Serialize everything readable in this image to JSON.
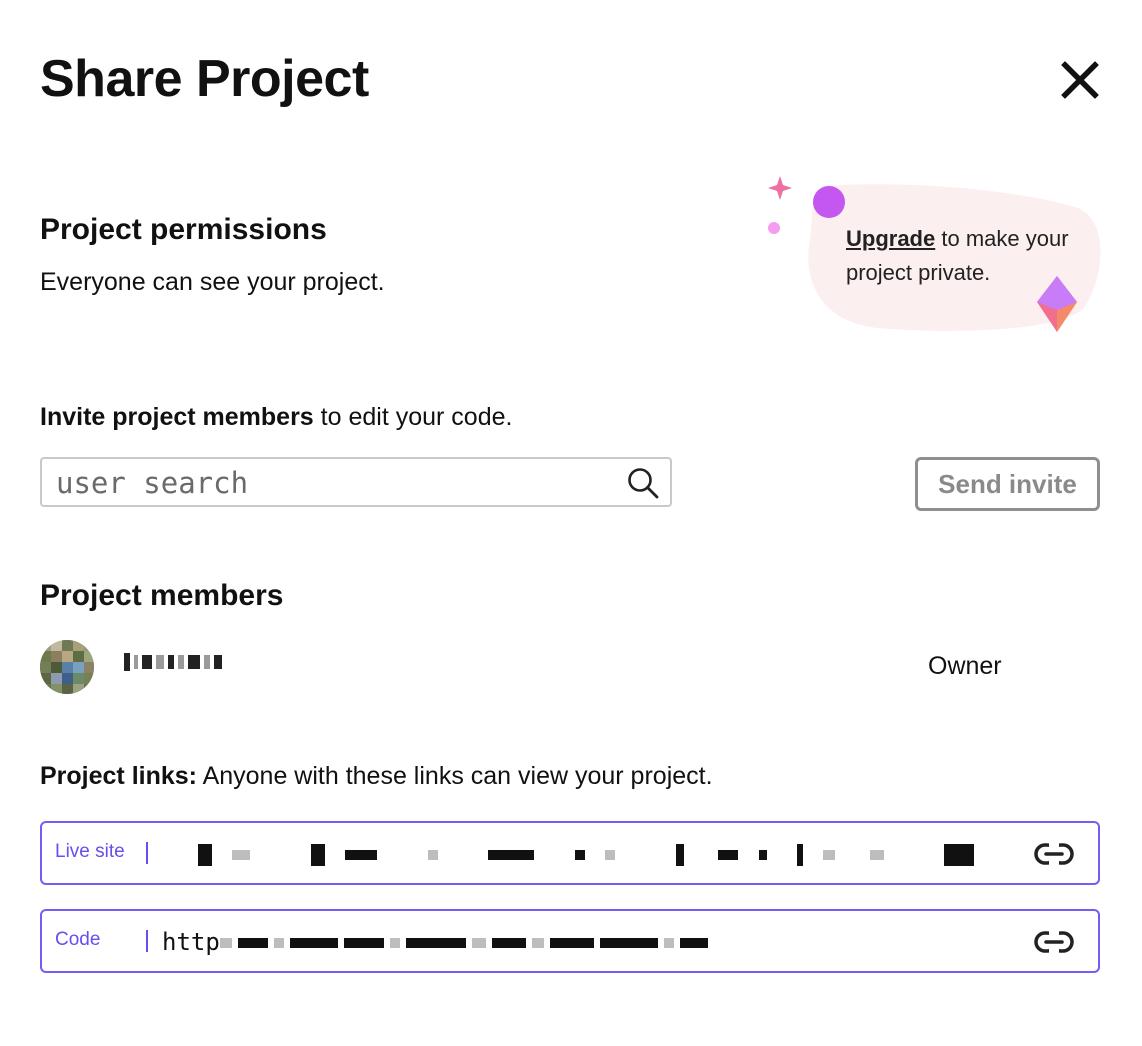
{
  "dialog": {
    "title": "Share Project",
    "close_icon": "close-icon"
  },
  "permissions": {
    "heading": "Project permissions",
    "description": "Everyone can see your project.",
    "promo": {
      "link_text": "Upgrade",
      "rest_text": " to make your project private.",
      "blob_color": "#fbefef",
      "accent_purple": "#c357f0",
      "accent_pink": "#ee6fa3"
    }
  },
  "invite": {
    "bold_text": "Invite project members",
    "rest_text": " to edit your code.",
    "search_placeholder": "user search",
    "search_icon": "search-icon",
    "send_button": "Send invite"
  },
  "members": {
    "heading": "Project members",
    "list": [
      {
        "name": "",
        "role": "Owner"
      }
    ]
  },
  "links": {
    "bold_text": "Project links:",
    "rest_text": " Anyone with these links can view your project.",
    "items": [
      {
        "label": "Live site",
        "url_prefix": "",
        "copy_icon": "link-icon"
      },
      {
        "label": "Code",
        "url_prefix": "http",
        "copy_icon": "link-icon"
      }
    ]
  },
  "colors": {
    "accent": "#6a4cf0",
    "border_gray": "#c9c9c9",
    "button_gray": "#8f8f8f"
  }
}
